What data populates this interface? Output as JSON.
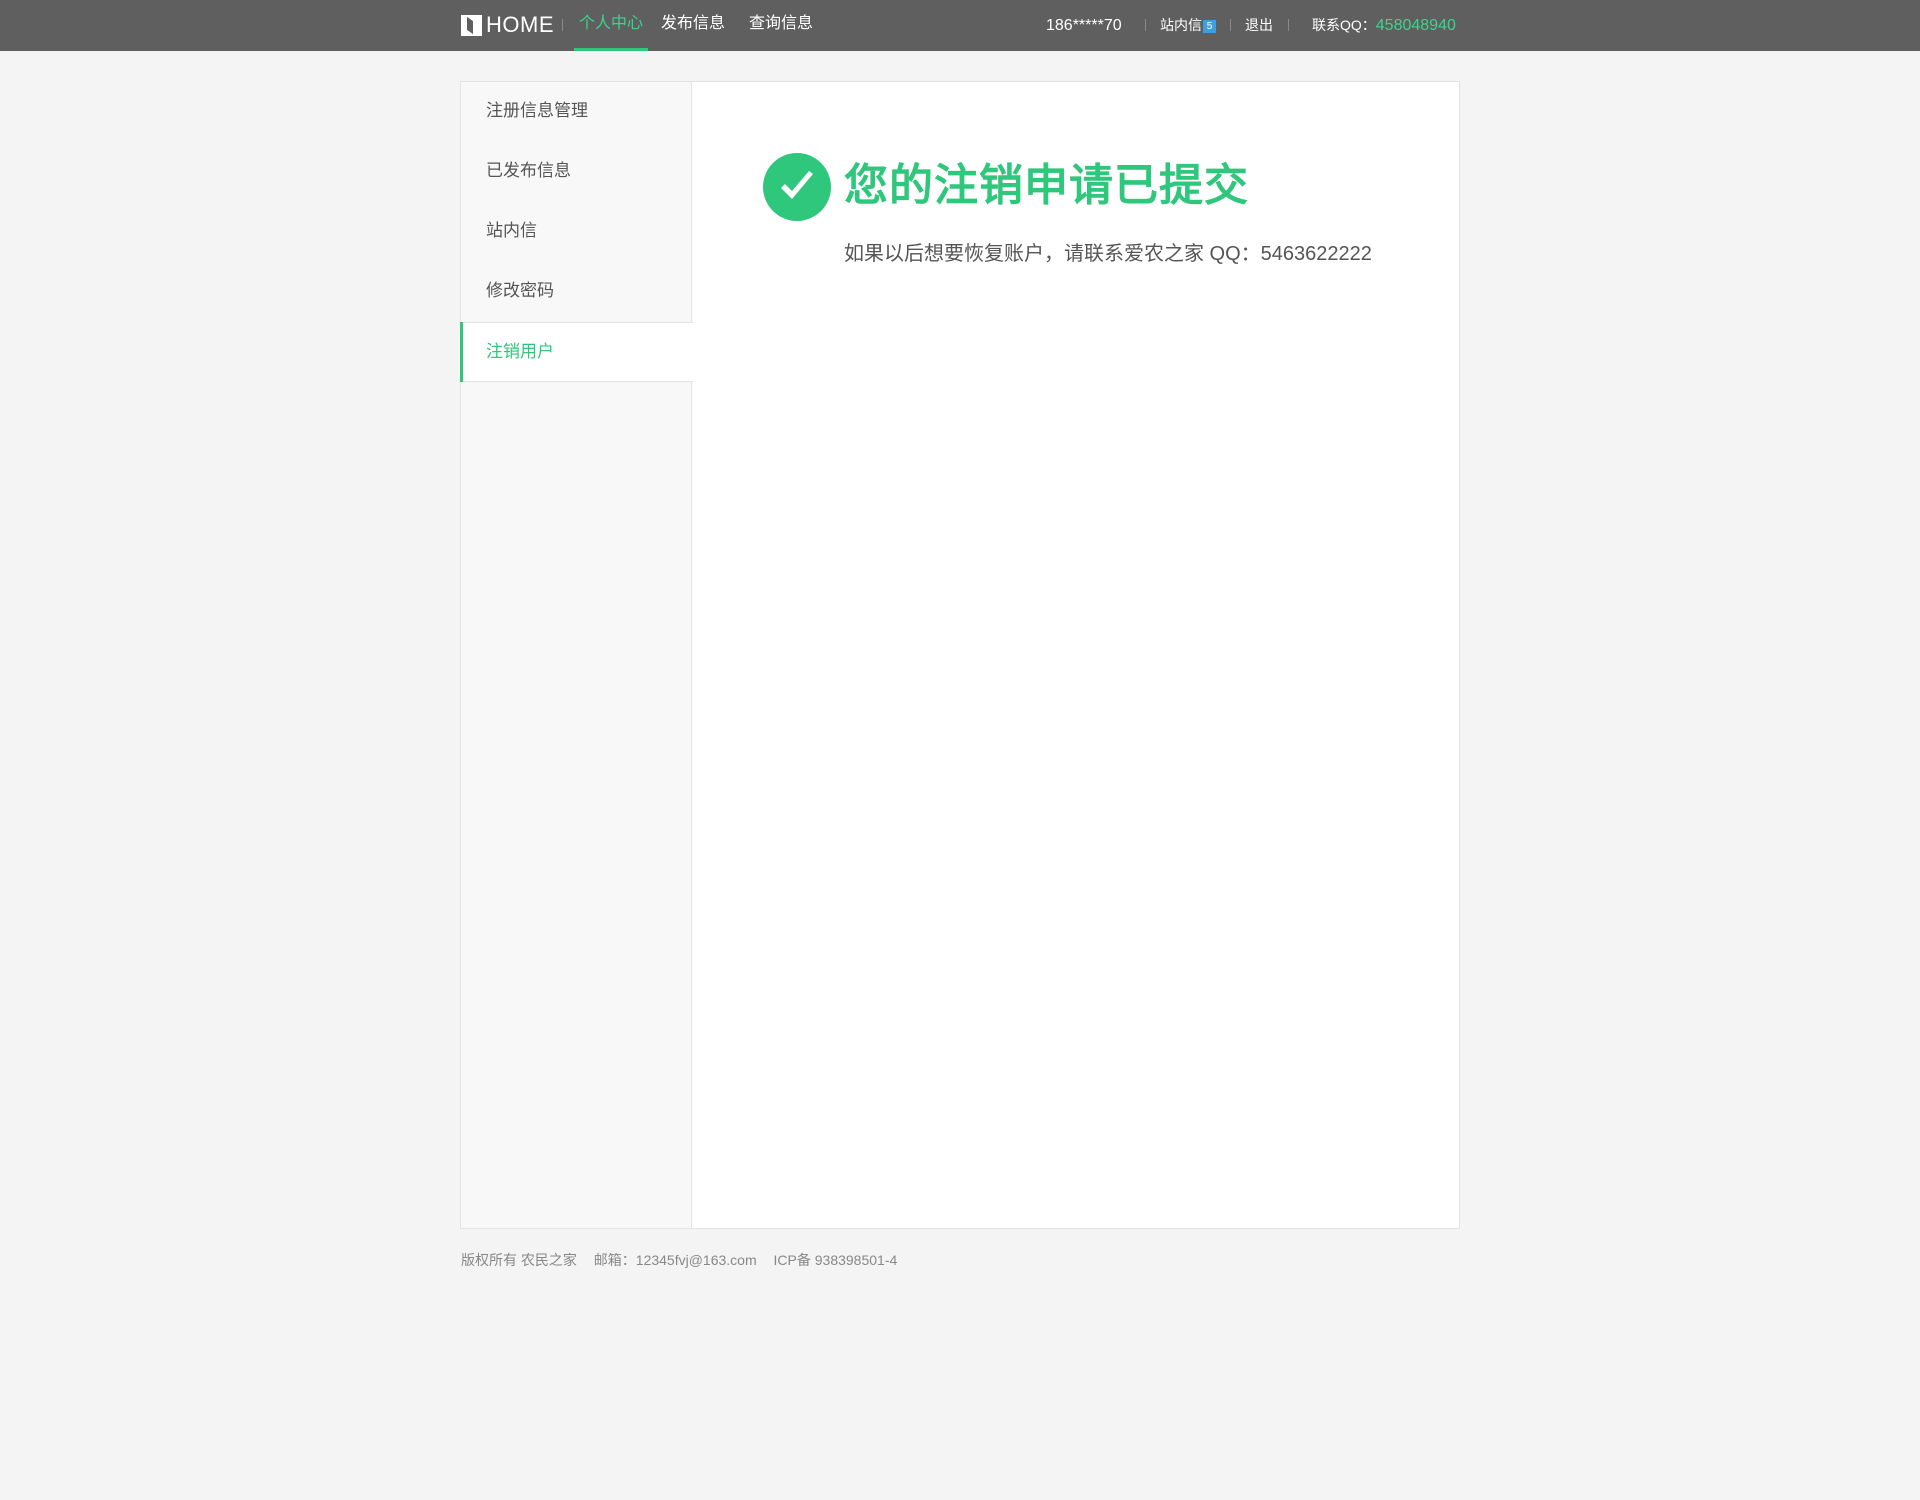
{
  "header": {
    "logo_text": "HOME",
    "nav": [
      {
        "label": "个人中心",
        "active": true
      },
      {
        "label": "发布信息",
        "active": false
      },
      {
        "label": "查询信息",
        "active": false
      }
    ],
    "user_phone": "186*****70",
    "messages_label": "站内信",
    "messages_count": "5",
    "logout_label": "退出",
    "contact_qq_label": "联系QQ：",
    "contact_qq_number": "458048940"
  },
  "sidebar": {
    "items": [
      {
        "label": "注册信息管理",
        "active": false
      },
      {
        "label": "已发布信息",
        "active": false
      },
      {
        "label": "站内信",
        "active": false
      },
      {
        "label": "修改密码",
        "active": false
      },
      {
        "label": "注销用户",
        "active": true
      }
    ]
  },
  "main": {
    "title": "您的注销申请已提交",
    "description": "如果以后想要恢复账户，请联系爱农之家 QQ：5463622222"
  },
  "footer": {
    "copyright": "版权所有 农民之家",
    "email": "邮箱：12345fvj@163.com",
    "icp": "ICP备 938398501-4"
  },
  "colors": {
    "topbar": "#5f5f5f",
    "accent_green": "#2ec77b",
    "badge_blue": "#3d9ee0",
    "background": "#f4f4f4"
  },
  "icons": {
    "logo": "logo-icon",
    "success": "check-circle-icon"
  }
}
